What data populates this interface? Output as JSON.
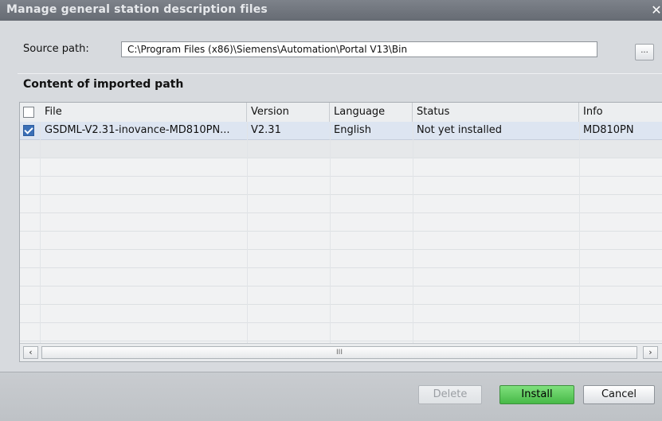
{
  "window": {
    "title": "Manage general station description files",
    "close_glyph": "✕"
  },
  "source": {
    "label": "Source path:",
    "path": "C:\\Program Files (x86)\\Siemens\\Automation\\Portal V13\\Bin",
    "browse_label": "..."
  },
  "content": {
    "section_title": "Content of imported path"
  },
  "table": {
    "columns": [
      "File",
      "Version",
      "Language",
      "Status",
      "Info"
    ],
    "rows": [
      {
        "checked": true,
        "file": "GSDML-V2.31-inovance-MD810PN...",
        "version": "V2.31",
        "language": "English",
        "status": "Not yet installed",
        "info": "MD810PN"
      }
    ]
  },
  "scrollbar": {
    "left_glyph": "‹",
    "right_glyph": "›",
    "thumb_grip": "III"
  },
  "buttons": {
    "delete": "Delete",
    "install": "Install",
    "cancel": "Cancel"
  },
  "colors": {
    "install_accent": "#47b947",
    "selected_row": "#dde5f1",
    "checkbox_checked": "#3a6fb7"
  }
}
